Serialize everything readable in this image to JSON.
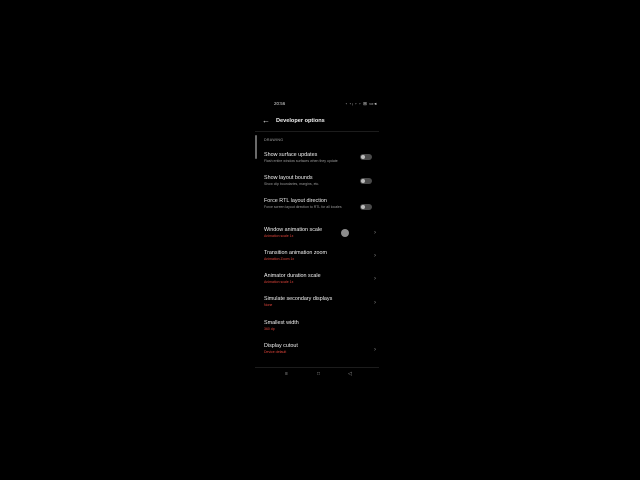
{
  "status_bar": {
    "time": "20:56",
    "icons_text": "◦ ◦ᵢ ◦ ◦ ⊞ ▭◂"
  },
  "app_bar": {
    "back_icon": "arrow-left-icon",
    "title": "Developer options"
  },
  "section": {
    "label": "DRAWING"
  },
  "items": [
    {
      "title": "Show surface updates",
      "subtitle": "Flash entire window surfaces when they update",
      "control": "toggle",
      "on": false
    },
    {
      "title": "Show layout bounds",
      "subtitle": "Show clip boundaries, margins, etc.",
      "control": "toggle",
      "on": false
    },
    {
      "title": "Force RTL layout direction",
      "subtitle": "Force screen layout direction to RTL for all locales",
      "control": "toggle",
      "on": false
    },
    {
      "title": "Window animation scale",
      "subtitle": "Animation scale 1x",
      "control": "chevron"
    },
    {
      "title": "Transition animation zoom",
      "subtitle": "Animation Zoom 1x",
      "control": "chevron"
    },
    {
      "title": "Animator duration scale",
      "subtitle": "Animation scale 1x",
      "control": "chevron"
    },
    {
      "title": "Simulate secondary displays",
      "subtitle": "None",
      "control": "chevron"
    },
    {
      "title": "Smallest width",
      "subtitle": "360 dp",
      "control": "none"
    },
    {
      "title": "Display cutout",
      "subtitle": "Device default",
      "control": "chevron"
    }
  ],
  "nav_bar": {
    "menu_icon": "≡",
    "home_icon": "□",
    "back_icon": "◁"
  },
  "colors": {
    "background": "#000000",
    "accent_red": "#e0443a",
    "toggle_track": "#4a4a4a"
  }
}
